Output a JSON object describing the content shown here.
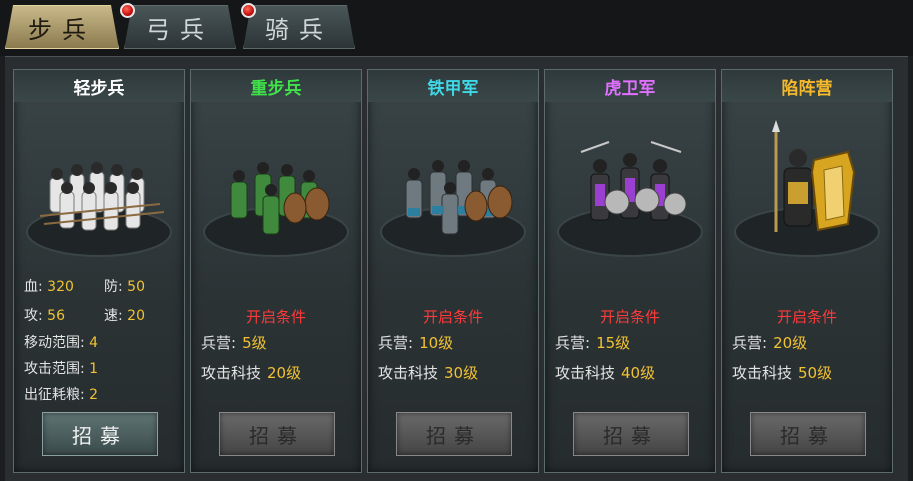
{
  "tabs": [
    {
      "label": "步兵",
      "active": true,
      "badge": false
    },
    {
      "label": "弓兵",
      "active": false,
      "badge": true
    },
    {
      "label": "骑兵",
      "active": false,
      "badge": true
    }
  ],
  "colors": {
    "tab_active": "#c9b98a",
    "badge": "#d01818",
    "value": "#f1c232",
    "condition": "#ff3a3a"
  },
  "cards": [
    {
      "name": "轻步兵",
      "name_color": "#ffffff",
      "unlocked": true,
      "art_icon": "light-infantry-squad-icon",
      "stats": {
        "hp_label": "血:",
        "hp": "320",
        "def_label": "防:",
        "def": "50",
        "atk_label": "攻:",
        "atk": "56",
        "spd_label": "速:",
        "spd": "20",
        "move_label": "移动范围:",
        "move": "4",
        "range_label": "攻击范围:",
        "range": "1",
        "food_label": "出征耗粮:",
        "food": "2"
      },
      "button": "招募"
    },
    {
      "name": "重步兵",
      "name_color": "#3fe24a",
      "unlocked": false,
      "art_icon": "heavy-infantry-squad-icon",
      "condition_title": "开启条件",
      "barracks_label": "兵营:",
      "barracks_level": "5级",
      "tech_label": "攻击科技",
      "tech_level": "20级",
      "button": "招募"
    },
    {
      "name": "铁甲军",
      "name_color": "#3fd8e6",
      "unlocked": false,
      "art_icon": "iron-armor-squad-icon",
      "condition_title": "开启条件",
      "barracks_label": "兵营:",
      "barracks_level": "10级",
      "tech_label": "攻击科技",
      "tech_level": "30级",
      "button": "招募"
    },
    {
      "name": "虎卫军",
      "name_color": "#e070ff",
      "unlocked": false,
      "art_icon": "tiger-guard-squad-icon",
      "condition_title": "开启条件",
      "barracks_label": "兵营:",
      "barracks_level": "15级",
      "tech_label": "攻击科技",
      "tech_level": "40级",
      "button": "招募"
    },
    {
      "name": "陷阵营",
      "name_color": "#f5b92a",
      "unlocked": false,
      "art_icon": "vanguard-camp-squad-icon",
      "condition_title": "开启条件",
      "barracks_label": "兵营:",
      "barracks_level": "20级",
      "tech_label": "攻击科技",
      "tech_level": "50级",
      "button": "招募"
    }
  ]
}
